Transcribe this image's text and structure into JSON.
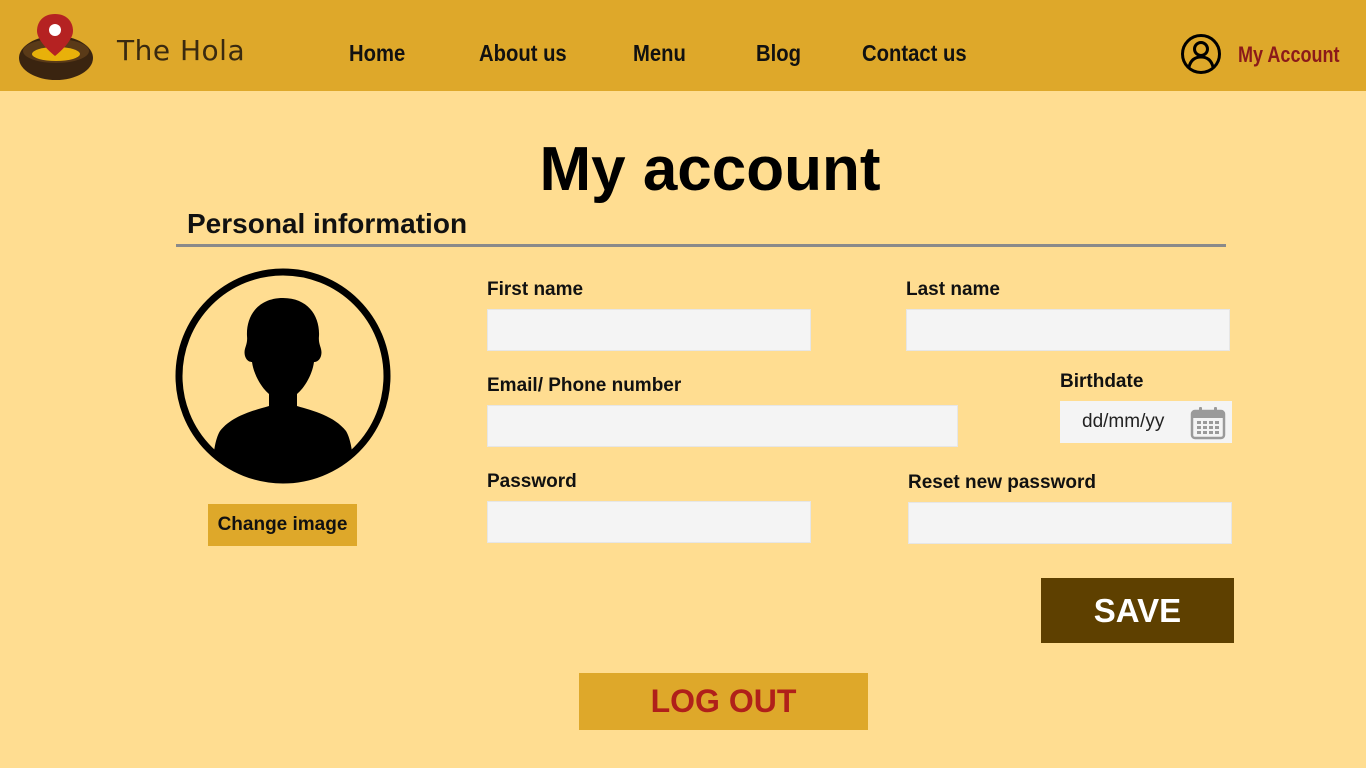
{
  "header": {
    "brand": "The Hola",
    "logo_icon": "location-pin-bowl-icon",
    "nav": [
      {
        "label": "Home"
      },
      {
        "label": "About us"
      },
      {
        "label": "Menu"
      },
      {
        "label": "Blog"
      },
      {
        "label": "Contact us"
      }
    ],
    "account_icon": "user-circle-icon",
    "account_label": "My Account"
  },
  "page": {
    "title": "My account",
    "section_title": "Personal information"
  },
  "profile": {
    "avatar_icon": "user-silhouette-icon",
    "change_image_label": "Change image"
  },
  "form": {
    "first_name": {
      "label": "First name",
      "value": ""
    },
    "last_name": {
      "label": "Last name",
      "value": ""
    },
    "email_phone": {
      "label": "Email/ Phone number",
      "value": ""
    },
    "birthdate": {
      "label": "Birthdate",
      "placeholder": "dd/mm/yy",
      "icon": "calendar-icon"
    },
    "password": {
      "label": "Password",
      "value": ""
    },
    "reset_password": {
      "label": "Reset new password",
      "value": ""
    }
  },
  "actions": {
    "save_label": "SAVE",
    "logout_label": "LOG OUT"
  },
  "colors": {
    "header_bg": "#dea82a",
    "page_bg": "#ffdd91",
    "save_bg": "#5e4000",
    "logout_text": "#b0201a",
    "account_text": "#8b1a1a"
  }
}
